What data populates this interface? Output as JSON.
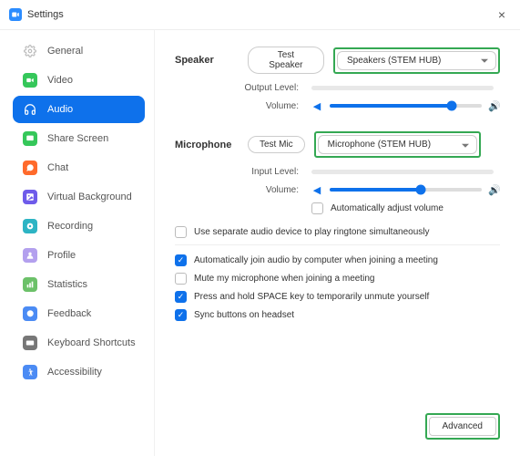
{
  "window": {
    "title": "Settings"
  },
  "sidebar": {
    "items": [
      {
        "label": "General"
      },
      {
        "label": "Video"
      },
      {
        "label": "Audio"
      },
      {
        "label": "Share Screen"
      },
      {
        "label": "Chat"
      },
      {
        "label": "Virtual Background"
      },
      {
        "label": "Recording"
      },
      {
        "label": "Profile"
      },
      {
        "label": "Statistics"
      },
      {
        "label": "Feedback"
      },
      {
        "label": "Keyboard Shortcuts"
      },
      {
        "label": "Accessibility"
      }
    ]
  },
  "speaker": {
    "heading": "Speaker",
    "test_button": "Test Speaker",
    "device": "Speakers (STEM HUB)",
    "output_label": "Output Level:",
    "volume_label": "Volume:"
  },
  "mic": {
    "heading": "Microphone",
    "test_button": "Test Mic",
    "device": "Microphone (STEM HUB)",
    "input_label": "Input Level:",
    "volume_label": "Volume:",
    "auto_adjust": "Automatically adjust volume"
  },
  "options": {
    "ringtone": "Use separate audio device to play ringtone simultaneously",
    "auto_join": "Automatically join audio by computer when joining a meeting",
    "mute_join": "Mute my microphone when joining a meeting",
    "space_unmute": "Press and hold SPACE key to temporarily unmute yourself",
    "sync_headset": "Sync buttons on headset"
  },
  "advanced": {
    "label": "Advanced"
  }
}
